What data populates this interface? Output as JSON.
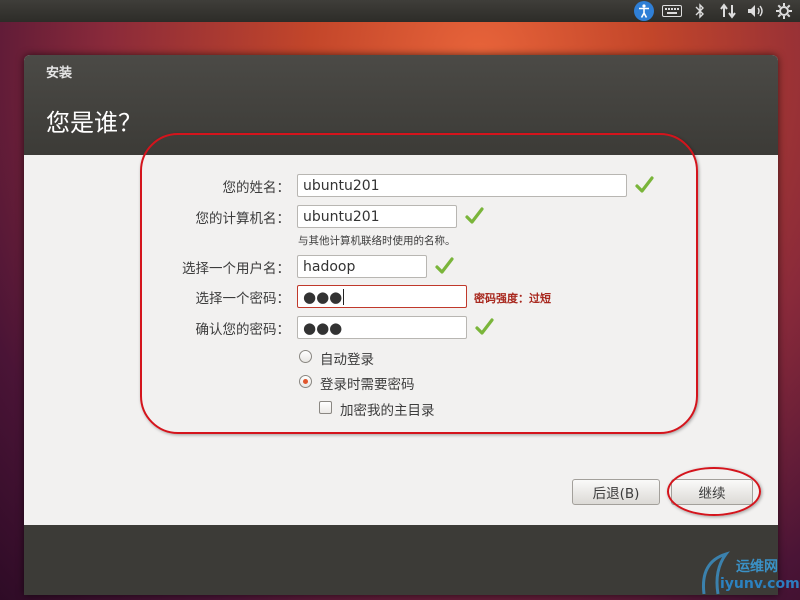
{
  "window": {
    "title": "安装",
    "page_title": "您是谁？"
  },
  "form": {
    "name": {
      "label": "您的姓名：",
      "value": "ubuntu201"
    },
    "computer": {
      "label": "您的计算机名：",
      "value": "ubuntu201",
      "hint": "与其他计算机联络时使用的名称。"
    },
    "username": {
      "label": "选择一个用户名：",
      "value": "hadoop"
    },
    "password": {
      "label": "选择一个密码：",
      "value": "●●●",
      "strength": "密码强度：过短"
    },
    "confirm": {
      "label": "确认您的密码：",
      "value": "●●●"
    },
    "auto_login": {
      "label": "自动登录",
      "selected": false
    },
    "require_password": {
      "label": "登录时需要密码",
      "selected": true
    },
    "encrypt_home": {
      "label": "加密我的主目录",
      "checked": false
    }
  },
  "buttons": {
    "back": "后退(B)",
    "continue": "继续"
  },
  "watermark": {
    "line1": "运维网",
    "line2": "iyunv.com"
  },
  "colors": {
    "accent": "#e0552c",
    "error": "#a8281e",
    "valid": "#7ab53a",
    "annotation": "#d4141c"
  }
}
